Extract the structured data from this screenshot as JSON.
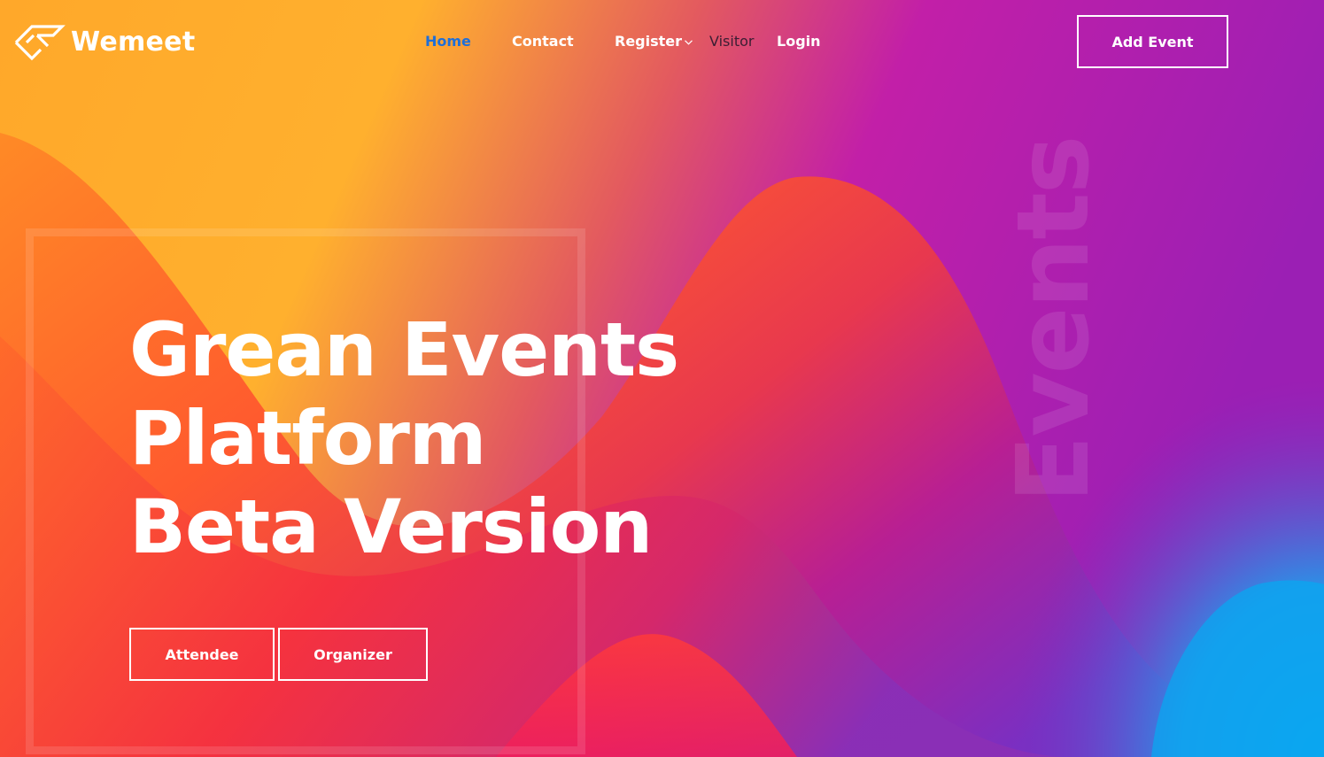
{
  "brand": {
    "name": "Wemeet"
  },
  "nav": {
    "items": [
      {
        "label": "Home",
        "active": true
      },
      {
        "label": "Contact"
      },
      {
        "label": "Register",
        "has_dropdown": true
      },
      {
        "label": "Visitor"
      },
      {
        "label": "Login"
      }
    ],
    "cta_label": "Add Event"
  },
  "hero": {
    "title_lines": [
      "Grean Events",
      "Platform",
      "Beta Version"
    ],
    "watermark": "Events",
    "buttons": [
      {
        "label": "Attendee"
      },
      {
        "label": "Organizer"
      }
    ]
  },
  "colors": {
    "active_link": "#1e6fd9",
    "orange": "#ffb22c",
    "red": "#f5234a",
    "purple": "#a51ab0",
    "blue": "#0aa7f0"
  },
  "icons": {
    "logo": "wemeet-logo-icon",
    "register_dropdown": "chevron-down-icon"
  }
}
